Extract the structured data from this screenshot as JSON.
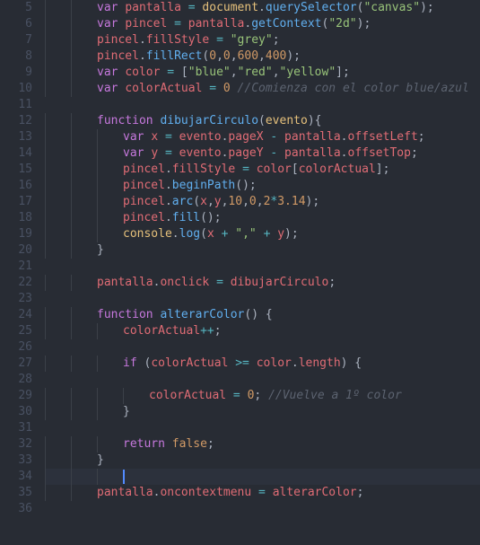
{
  "gutter": {
    "start": 5,
    "end": 36
  },
  "highlight_line": 34,
  "lines": [
    {
      "n": 5,
      "i": 2,
      "t": [
        [
          "k",
          "var"
        ],
        [
          "p",
          " "
        ],
        [
          "d",
          "pantalla"
        ],
        [
          "p",
          " "
        ],
        [
          "o",
          "="
        ],
        [
          "p",
          " "
        ],
        [
          "pa",
          "document"
        ],
        [
          "p",
          "."
        ],
        [
          "fn",
          "querySelector"
        ],
        [
          "p",
          "("
        ],
        [
          "s",
          "\"canvas\""
        ],
        [
          "p",
          ");"
        ]
      ]
    },
    {
      "n": 6,
      "i": 2,
      "t": [
        [
          "k",
          "var"
        ],
        [
          "p",
          " "
        ],
        [
          "d",
          "pincel"
        ],
        [
          "p",
          " "
        ],
        [
          "o",
          "="
        ],
        [
          "p",
          " "
        ],
        [
          "d",
          "pantalla"
        ],
        [
          "p",
          "."
        ],
        [
          "fn",
          "getContext"
        ],
        [
          "p",
          "("
        ],
        [
          "s",
          "\"2d\""
        ],
        [
          "p",
          ");"
        ]
      ]
    },
    {
      "n": 7,
      "i": 2,
      "t": [
        [
          "d",
          "pincel"
        ],
        [
          "p",
          "."
        ],
        [
          "d",
          "fillStyle"
        ],
        [
          "p",
          " "
        ],
        [
          "o",
          "="
        ],
        [
          "p",
          " "
        ],
        [
          "s",
          "\"grey\""
        ],
        [
          "p",
          ";"
        ]
      ]
    },
    {
      "n": 8,
      "i": 2,
      "t": [
        [
          "d",
          "pincel"
        ],
        [
          "p",
          "."
        ],
        [
          "fn",
          "fillRect"
        ],
        [
          "p",
          "("
        ],
        [
          "n",
          "0"
        ],
        [
          "p",
          ","
        ],
        [
          "n",
          "0"
        ],
        [
          "p",
          ","
        ],
        [
          "n",
          "600"
        ],
        [
          "p",
          ","
        ],
        [
          "n",
          "400"
        ],
        [
          "p",
          ");"
        ]
      ]
    },
    {
      "n": 9,
      "i": 2,
      "t": [
        [
          "k",
          "var"
        ],
        [
          "p",
          " "
        ],
        [
          "d",
          "color"
        ],
        [
          "p",
          " "
        ],
        [
          "o",
          "="
        ],
        [
          "p",
          " ["
        ],
        [
          "s",
          "\"blue\""
        ],
        [
          "p",
          ","
        ],
        [
          "s",
          "\"red\""
        ],
        [
          "p",
          ","
        ],
        [
          "s",
          "\"yellow\""
        ],
        [
          "p",
          "];"
        ]
      ]
    },
    {
      "n": 10,
      "i": 2,
      "t": [
        [
          "k",
          "var"
        ],
        [
          "p",
          " "
        ],
        [
          "d",
          "colorActual"
        ],
        [
          "p",
          " "
        ],
        [
          "o",
          "="
        ],
        [
          "p",
          " "
        ],
        [
          "n",
          "0"
        ],
        [
          "p",
          " "
        ],
        [
          "c",
          "//Comienza con el color blue/azul"
        ]
      ]
    },
    {
      "n": 11,
      "i": 0,
      "t": []
    },
    {
      "n": 12,
      "i": 2,
      "t": [
        [
          "k",
          "function"
        ],
        [
          "p",
          " "
        ],
        [
          "fd",
          "dibujarCirculo"
        ],
        [
          "p",
          "("
        ],
        [
          "pa",
          "evento"
        ],
        [
          "p",
          "){"
        ]
      ]
    },
    {
      "n": 13,
      "i": 3,
      "t": [
        [
          "k",
          "var"
        ],
        [
          "p",
          " "
        ],
        [
          "d",
          "x"
        ],
        [
          "p",
          " "
        ],
        [
          "o",
          "="
        ],
        [
          "p",
          " "
        ],
        [
          "d",
          "evento"
        ],
        [
          "p",
          "."
        ],
        [
          "d",
          "pageX"
        ],
        [
          "p",
          " "
        ],
        [
          "o",
          "-"
        ],
        [
          "p",
          " "
        ],
        [
          "d",
          "pantalla"
        ],
        [
          "p",
          "."
        ],
        [
          "d",
          "offsetLeft"
        ],
        [
          "p",
          ";"
        ]
      ]
    },
    {
      "n": 14,
      "i": 3,
      "t": [
        [
          "k",
          "var"
        ],
        [
          "p",
          " "
        ],
        [
          "d",
          "y"
        ],
        [
          "p",
          " "
        ],
        [
          "o",
          "="
        ],
        [
          "p",
          " "
        ],
        [
          "d",
          "evento"
        ],
        [
          "p",
          "."
        ],
        [
          "d",
          "pageY"
        ],
        [
          "p",
          " "
        ],
        [
          "o",
          "-"
        ],
        [
          "p",
          " "
        ],
        [
          "d",
          "pantalla"
        ],
        [
          "p",
          "."
        ],
        [
          "d",
          "offsetTop"
        ],
        [
          "p",
          ";"
        ]
      ]
    },
    {
      "n": 15,
      "i": 3,
      "t": [
        [
          "d",
          "pincel"
        ],
        [
          "p",
          "."
        ],
        [
          "d",
          "fillStyle"
        ],
        [
          "p",
          " "
        ],
        [
          "o",
          "="
        ],
        [
          "p",
          " "
        ],
        [
          "d",
          "color"
        ],
        [
          "p",
          "["
        ],
        [
          "d",
          "colorActual"
        ],
        [
          "p",
          "];"
        ]
      ]
    },
    {
      "n": 16,
      "i": 3,
      "t": [
        [
          "d",
          "pincel"
        ],
        [
          "p",
          "."
        ],
        [
          "fn",
          "beginPath"
        ],
        [
          "p",
          "();"
        ]
      ]
    },
    {
      "n": 17,
      "i": 3,
      "t": [
        [
          "d",
          "pincel"
        ],
        [
          "p",
          "."
        ],
        [
          "fn",
          "arc"
        ],
        [
          "p",
          "("
        ],
        [
          "d",
          "x"
        ],
        [
          "p",
          ","
        ],
        [
          "d",
          "y"
        ],
        [
          "p",
          ","
        ],
        [
          "n",
          "10"
        ],
        [
          "p",
          ","
        ],
        [
          "n",
          "0"
        ],
        [
          "p",
          ","
        ],
        [
          "n",
          "2"
        ],
        [
          "o",
          "*"
        ],
        [
          "n",
          "3.14"
        ],
        [
          "p",
          ");"
        ]
      ]
    },
    {
      "n": 18,
      "i": 3,
      "t": [
        [
          "d",
          "pincel"
        ],
        [
          "p",
          "."
        ],
        [
          "fn",
          "fill"
        ],
        [
          "p",
          "();"
        ]
      ]
    },
    {
      "n": 19,
      "i": 3,
      "t": [
        [
          "pa",
          "console"
        ],
        [
          "p",
          "."
        ],
        [
          "fn",
          "log"
        ],
        [
          "p",
          "("
        ],
        [
          "d",
          "x"
        ],
        [
          "p",
          " "
        ],
        [
          "o",
          "+"
        ],
        [
          "p",
          " "
        ],
        [
          "s",
          "\",\""
        ],
        [
          "p",
          " "
        ],
        [
          "o",
          "+"
        ],
        [
          "p",
          " "
        ],
        [
          "d",
          "y"
        ],
        [
          "p",
          ");"
        ]
      ]
    },
    {
      "n": 20,
      "i": 2,
      "t": [
        [
          "p",
          "}"
        ]
      ]
    },
    {
      "n": 21,
      "i": 0,
      "t": []
    },
    {
      "n": 22,
      "i": 2,
      "t": [
        [
          "d",
          "pantalla"
        ],
        [
          "p",
          "."
        ],
        [
          "d",
          "onclick"
        ],
        [
          "p",
          " "
        ],
        [
          "o",
          "="
        ],
        [
          "p",
          " "
        ],
        [
          "d",
          "dibujarCirculo"
        ],
        [
          "p",
          ";"
        ]
      ]
    },
    {
      "n": 23,
      "i": 0,
      "t": []
    },
    {
      "n": 24,
      "i": 2,
      "t": [
        [
          "k",
          "function"
        ],
        [
          "p",
          " "
        ],
        [
          "fd",
          "alterarColor"
        ],
        [
          "p",
          "() {"
        ]
      ]
    },
    {
      "n": 25,
      "i": 3,
      "t": [
        [
          "d",
          "colorActual"
        ],
        [
          "o",
          "++"
        ],
        [
          "p",
          ";"
        ]
      ]
    },
    {
      "n": 26,
      "i": 0,
      "t": []
    },
    {
      "n": 27,
      "i": 3,
      "t": [
        [
          "k",
          "if"
        ],
        [
          "p",
          " ("
        ],
        [
          "d",
          "colorActual"
        ],
        [
          "p",
          " "
        ],
        [
          "o",
          ">="
        ],
        [
          "p",
          " "
        ],
        [
          "d",
          "color"
        ],
        [
          "p",
          "."
        ],
        [
          "d",
          "length"
        ],
        [
          "p",
          ") {"
        ]
      ]
    },
    {
      "n": 28,
      "i": 0,
      "t": []
    },
    {
      "n": 29,
      "i": 4,
      "t": [
        [
          "d",
          "colorActual"
        ],
        [
          "p",
          " "
        ],
        [
          "o",
          "="
        ],
        [
          "p",
          " "
        ],
        [
          "n",
          "0"
        ],
        [
          "p",
          "; "
        ],
        [
          "c",
          "//Vuelve a 1º color"
        ]
      ]
    },
    {
      "n": 30,
      "i": 3,
      "t": [
        [
          "p",
          "}"
        ]
      ]
    },
    {
      "n": 31,
      "i": 0,
      "t": []
    },
    {
      "n": 32,
      "i": 3,
      "t": [
        [
          "k",
          "return"
        ],
        [
          "p",
          " "
        ],
        [
          "n",
          "false"
        ],
        [
          "p",
          ";"
        ]
      ]
    },
    {
      "n": 33,
      "i": 2,
      "t": [
        [
          "p",
          "}"
        ]
      ]
    },
    {
      "n": 34,
      "i": 3,
      "t": [],
      "cursor": true
    },
    {
      "n": 35,
      "i": 2,
      "t": [
        [
          "d",
          "pantalla"
        ],
        [
          "p",
          "."
        ],
        [
          "d",
          "oncontextmenu"
        ],
        [
          "p",
          " "
        ],
        [
          "o",
          "="
        ],
        [
          "p",
          " "
        ],
        [
          "d",
          "alterarColor"
        ],
        [
          "p",
          ";"
        ]
      ]
    },
    {
      "n": 36,
      "i": 0,
      "t": []
    }
  ]
}
